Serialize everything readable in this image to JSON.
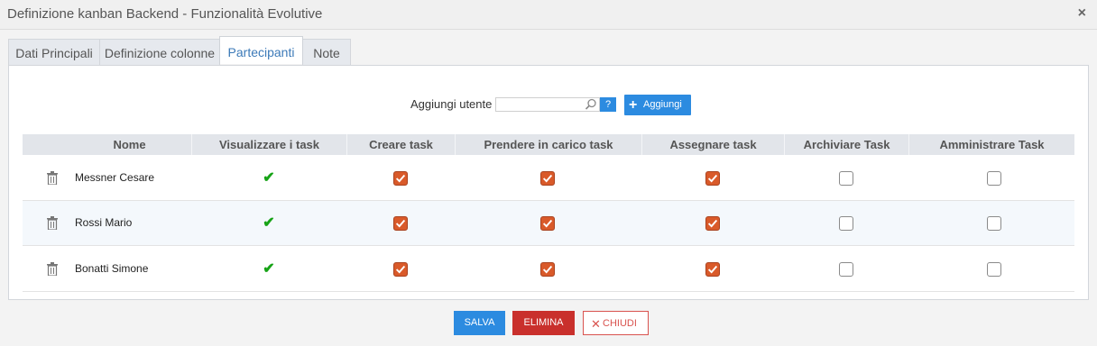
{
  "window": {
    "title": "Definizione kanban Backend - Funzionalità Evolutive",
    "close_glyph": "×"
  },
  "tabs": [
    {
      "label": "Dati Principali",
      "active": false
    },
    {
      "label": "Definizione colonne",
      "active": false
    },
    {
      "label": "Partecipanti",
      "active": true
    },
    {
      "label": "Note",
      "active": false
    }
  ],
  "add_user": {
    "label": "Aggiungi utente",
    "value": "",
    "placeholder": "",
    "help_label": "?",
    "button_label": "Aggiungi",
    "button_icon": "plus-icon"
  },
  "table": {
    "columns": [
      "Nome",
      "Visualizzare i task",
      "Creare task",
      "Prendere in carico task",
      "Assegnare task",
      "Archiviare Task",
      "Amministrare Task"
    ],
    "rows": [
      {
        "name": "Messner Cesare",
        "visualizzare": true,
        "creare": true,
        "prendere": true,
        "assegnare": true,
        "archiviare": false,
        "amministrare": false
      },
      {
        "name": "Rossi Mario",
        "visualizzare": true,
        "creare": true,
        "prendere": true,
        "assegnare": true,
        "archiviare": false,
        "amministrare": false
      },
      {
        "name": "Bonatti Simone",
        "visualizzare": true,
        "creare": true,
        "prendere": true,
        "assegnare": true,
        "archiviare": false,
        "amministrare": false
      }
    ]
  },
  "footer": {
    "save_label": "SALVA",
    "delete_label": "ELIMINA",
    "close_label": "CHIUDI",
    "close_glyph": "✕"
  },
  "colors": {
    "accent": "#2c8be0",
    "checked": "#d95a2a",
    "danger": "#c9302c",
    "ok": "#17a317"
  }
}
